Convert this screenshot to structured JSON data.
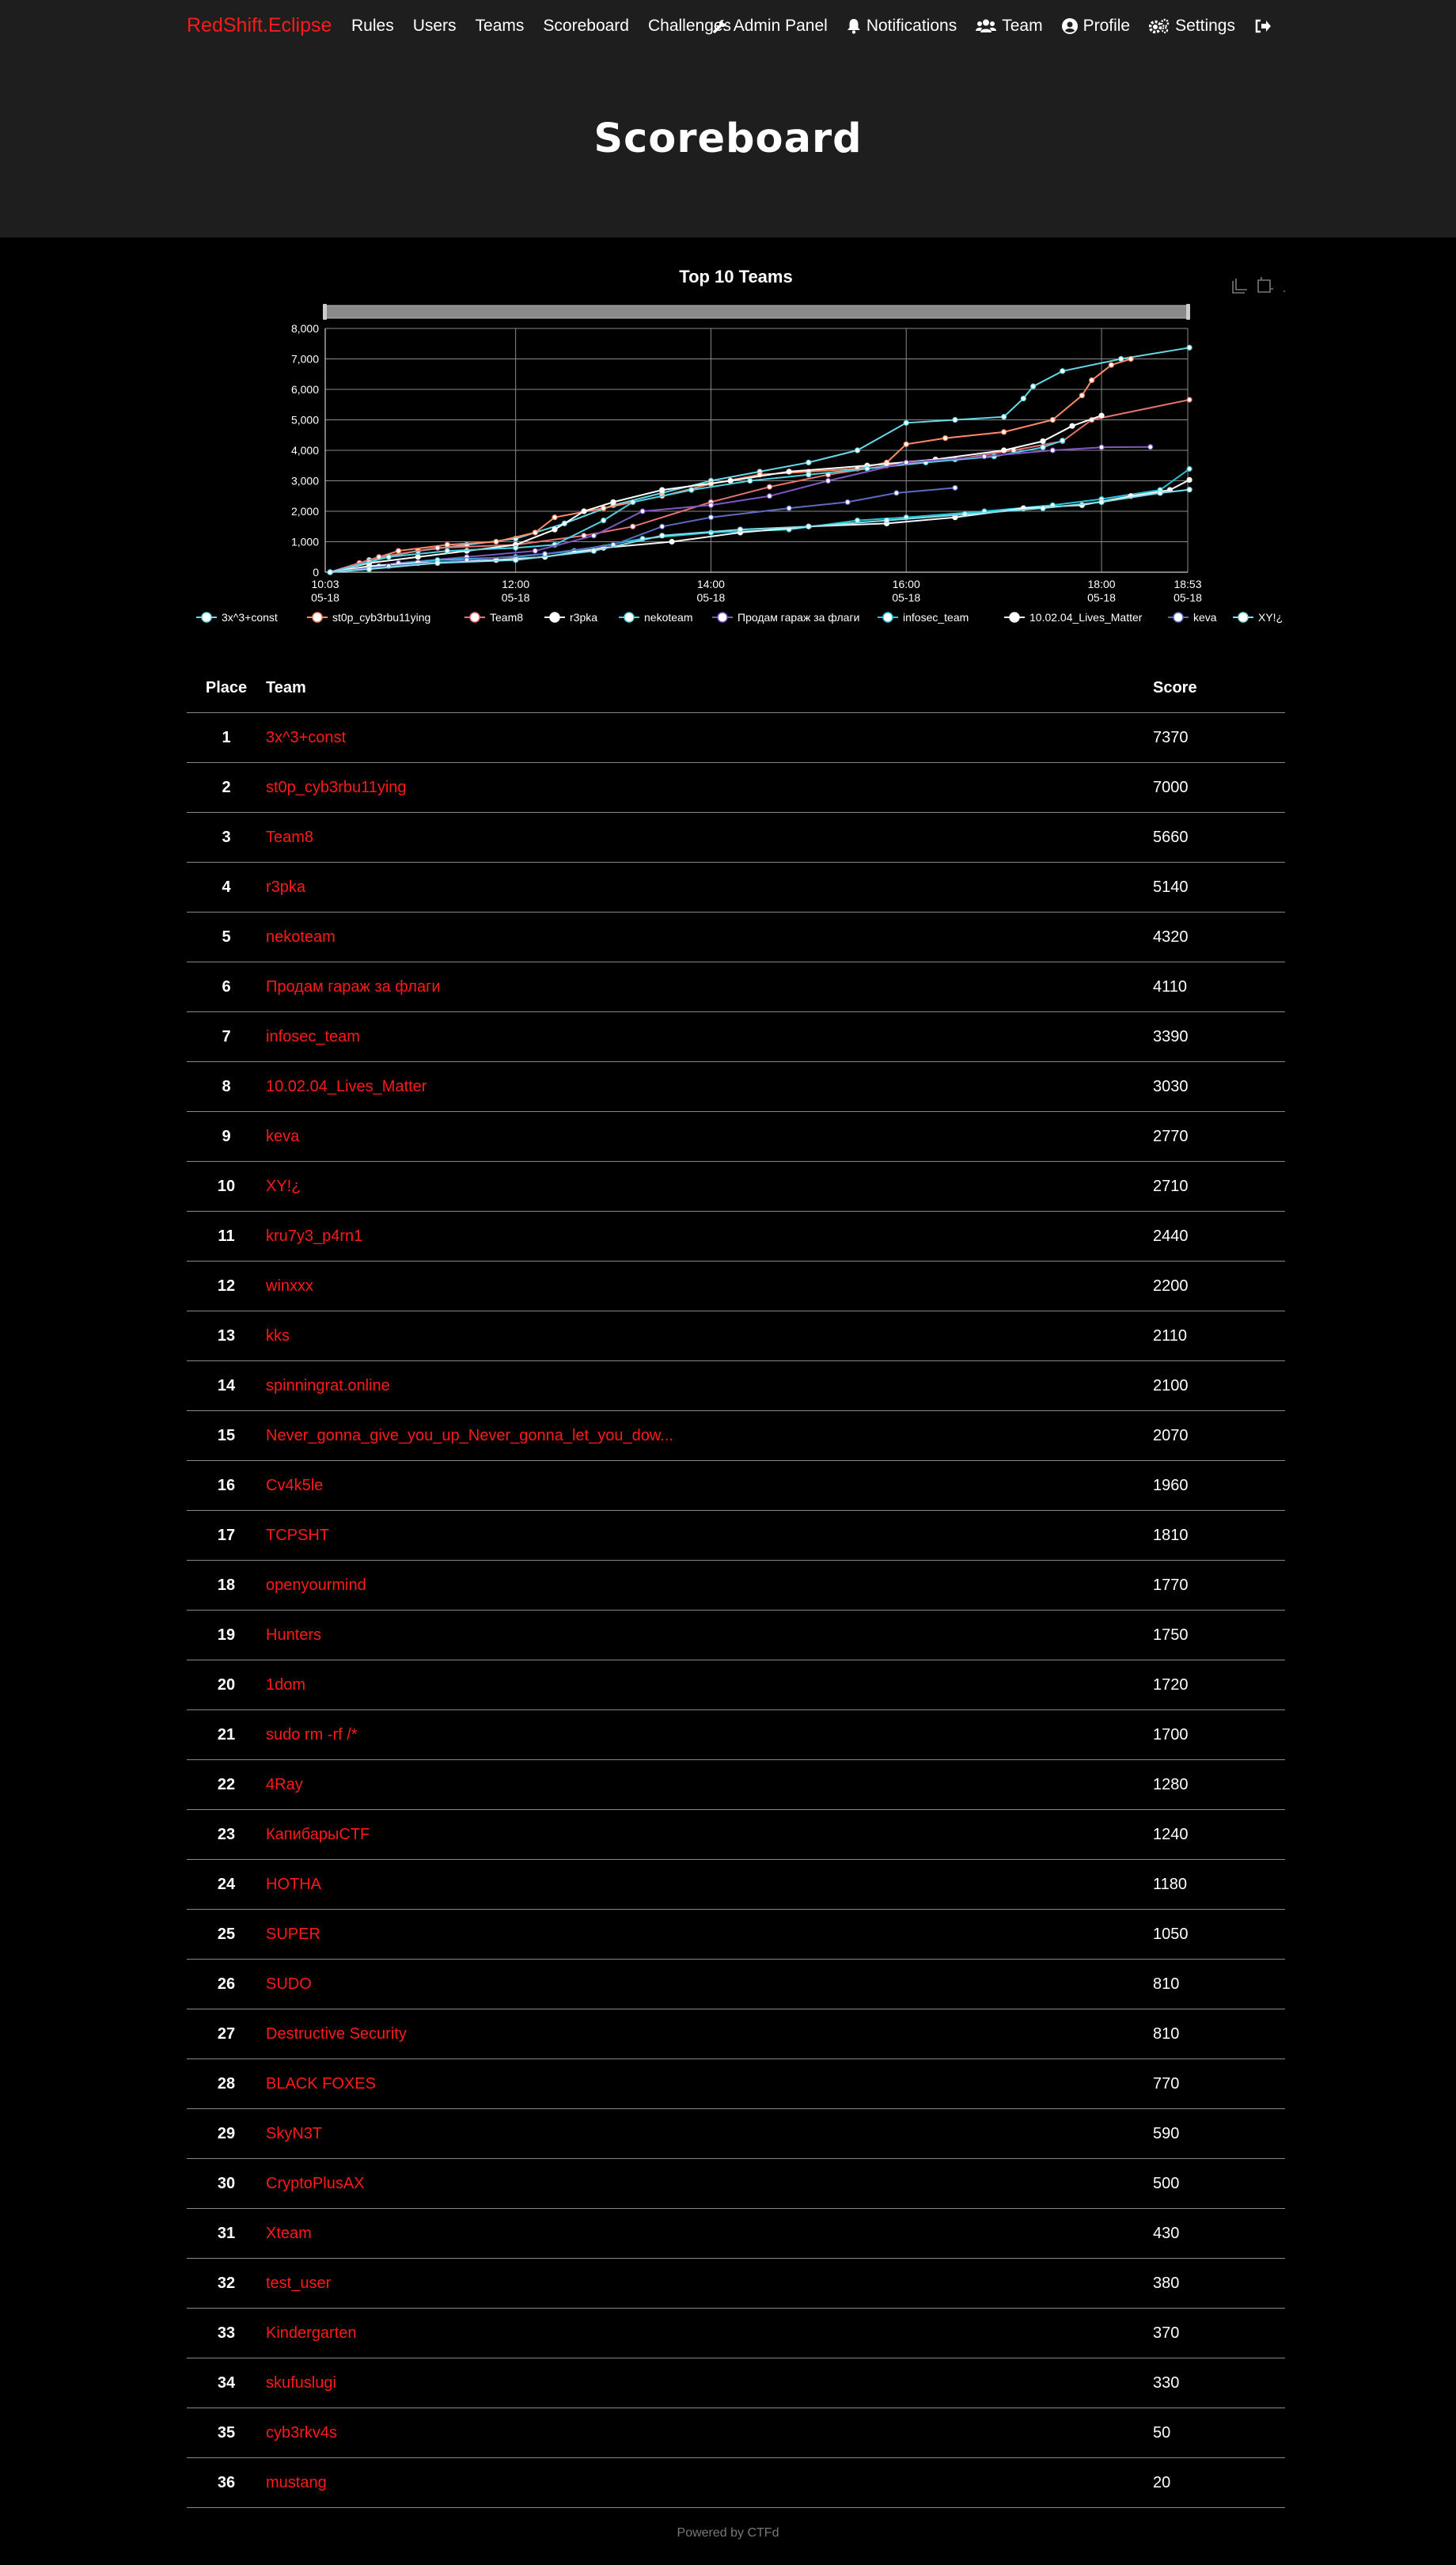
{
  "nav": {
    "brand": "RedShift.Eclipse",
    "left": [
      "Rules",
      "Users",
      "Teams",
      "Scoreboard",
      "Challenges"
    ],
    "right": {
      "admin": "Admin Panel",
      "notifications": "Notifications",
      "team": "Team",
      "profile": "Profile",
      "settings": "Settings"
    }
  },
  "page_title": "Scoreboard",
  "colors": {
    "accent": "#ff1a1a",
    "background": "#000000",
    "header_bg": "#1e1e1e"
  },
  "toolbox_icons": [
    "zoom-icon",
    "zoom-reset-icon",
    "download-icon"
  ],
  "chart_data": {
    "type": "line",
    "title": "Top 10 Teams",
    "xlabel": "",
    "ylabel": "",
    "ylim": [
      0,
      8000
    ],
    "x_range": [
      "10:03 05-18",
      "18:53 05-18"
    ],
    "x_ticks": [
      {
        "time": "10:03",
        "date": "05-18",
        "hours": 10.05
      },
      {
        "time": "12:00",
        "date": "05-18",
        "hours": 12.0
      },
      {
        "time": "14:00",
        "date": "05-18",
        "hours": 14.0
      },
      {
        "time": "16:00",
        "date": "05-18",
        "hours": 16.0
      },
      {
        "time": "18:00",
        "date": "05-18",
        "hours": 18.0
      },
      {
        "time": "18:53",
        "date": "05-18",
        "hours": 18.883
      }
    ],
    "y_ticks": [
      "0",
      "1,000",
      "2,000",
      "3,000",
      "4,000",
      "5,000",
      "6,000",
      "7,000",
      "8,000"
    ],
    "grid": true,
    "legend_position": "bottom",
    "series": [
      {
        "name": "3x^3+const",
        "color": "#66d9e8",
        "points": [
          [
            10.1,
            0
          ],
          [
            10.5,
            400
          ],
          [
            11.0,
            700
          ],
          [
            11.5,
            900
          ],
          [
            12.0,
            1100
          ],
          [
            12.5,
            1600
          ],
          [
            13.0,
            2200
          ],
          [
            13.5,
            2600
          ],
          [
            14.0,
            3000
          ],
          [
            14.5,
            3300
          ],
          [
            15.0,
            3600
          ],
          [
            15.5,
            4000
          ],
          [
            16.0,
            4900
          ],
          [
            16.5,
            5000
          ],
          [
            17.0,
            5100
          ],
          [
            17.2,
            5700
          ],
          [
            17.3,
            6100
          ],
          [
            17.6,
            6600
          ],
          [
            18.2,
            7000
          ],
          [
            18.9,
            7370
          ]
        ]
      },
      {
        "name": "st0p_cyb3rbu11ying",
        "color": "#ff8a65",
        "points": [
          [
            10.1,
            0
          ],
          [
            10.4,
            300
          ],
          [
            10.8,
            700
          ],
          [
            11.3,
            900
          ],
          [
            11.8,
            1000
          ],
          [
            12.2,
            1300
          ],
          [
            12.4,
            1800
          ],
          [
            12.9,
            2100
          ],
          [
            13.5,
            2500
          ],
          [
            14.0,
            2900
          ],
          [
            14.5,
            3200
          ],
          [
            15.0,
            3300
          ],
          [
            15.5,
            3400
          ],
          [
            15.8,
            3600
          ],
          [
            16.0,
            4200
          ],
          [
            16.4,
            4400
          ],
          [
            17.0,
            4600
          ],
          [
            17.5,
            5000
          ],
          [
            17.8,
            5800
          ],
          [
            17.9,
            6300
          ],
          [
            18.1,
            6800
          ],
          [
            18.3,
            7000
          ]
        ]
      },
      {
        "name": "Team8",
        "color": "#e57373",
        "points": [
          [
            10.1,
            0
          ],
          [
            10.6,
            500
          ],
          [
            11.2,
            800
          ],
          [
            12.0,
            900
          ],
          [
            12.7,
            1200
          ],
          [
            13.2,
            1500
          ],
          [
            14.0,
            2300
          ],
          [
            14.6,
            2800
          ],
          [
            15.2,
            3200
          ],
          [
            15.8,
            3500
          ],
          [
            16.5,
            3700
          ],
          [
            17.1,
            4000
          ],
          [
            17.6,
            4300
          ],
          [
            17.9,
            5000
          ],
          [
            18.9,
            5660
          ]
        ]
      },
      {
        "name": "r3pka",
        "color": "#ffffff",
        "points": [
          [
            10.1,
            0
          ],
          [
            10.5,
            300
          ],
          [
            11.0,
            500
          ],
          [
            11.5,
            700
          ],
          [
            12.0,
            900
          ],
          [
            12.4,
            1400
          ],
          [
            12.7,
            2000
          ],
          [
            13.0,
            2300
          ],
          [
            13.5,
            2700
          ],
          [
            14.2,
            3000
          ],
          [
            14.8,
            3300
          ],
          [
            15.6,
            3500
          ],
          [
            16.3,
            3700
          ],
          [
            17.0,
            4000
          ],
          [
            17.4,
            4300
          ],
          [
            17.7,
            4800
          ],
          [
            18.0,
            5140
          ]
        ]
      },
      {
        "name": "nekoteam",
        "color": "#4dd0e1",
        "points": [
          [
            10.1,
            0
          ],
          [
            10.7,
            500
          ],
          [
            11.3,
            700
          ],
          [
            12.0,
            800
          ],
          [
            12.4,
            900
          ],
          [
            12.9,
            1700
          ],
          [
            13.2,
            2300
          ],
          [
            13.8,
            2700
          ],
          [
            14.4,
            3000
          ],
          [
            15.0,
            3200
          ],
          [
            15.6,
            3400
          ],
          [
            16.2,
            3600
          ],
          [
            16.9,
            3800
          ],
          [
            17.4,
            4100
          ],
          [
            17.6,
            4320
          ]
        ]
      },
      {
        "name": "Продам гараж за флаги",
        "color": "#7e57c2",
        "points": [
          [
            10.1,
            0
          ],
          [
            10.8,
            300
          ],
          [
            11.5,
            500
          ],
          [
            12.2,
            700
          ],
          [
            12.8,
            1200
          ],
          [
            13.3,
            2000
          ],
          [
            14.0,
            2200
          ],
          [
            14.6,
            2500
          ],
          [
            15.2,
            3000
          ],
          [
            16.0,
            3600
          ],
          [
            16.8,
            3800
          ],
          [
            17.5,
            4000
          ],
          [
            18.0,
            4100
          ],
          [
            18.5,
            4110
          ]
        ]
      },
      {
        "name": "infosec_team",
        "color": "#26c6da",
        "points": [
          [
            10.1,
            0
          ],
          [
            10.6,
            200
          ],
          [
            11.2,
            400
          ],
          [
            12.0,
            500
          ],
          [
            12.6,
            700
          ],
          [
            13.3,
            1100
          ],
          [
            14.0,
            1300
          ],
          [
            14.8,
            1400
          ],
          [
            15.5,
            1700
          ],
          [
            16.0,
            1800
          ],
          [
            16.8,
            2000
          ],
          [
            17.5,
            2200
          ],
          [
            18.0,
            2400
          ],
          [
            18.6,
            2700
          ],
          [
            18.9,
            3390
          ]
        ]
      },
      {
        "name": "10.02.04_Lives_Matter",
        "color": "#f5f5f5",
        "points": [
          [
            10.1,
            0
          ],
          [
            10.5,
            200
          ],
          [
            11.0,
            300
          ],
          [
            11.8,
            400
          ],
          [
            12.3,
            500
          ],
          [
            12.9,
            800
          ],
          [
            13.6,
            1000
          ],
          [
            14.3,
            1300
          ],
          [
            15.0,
            1500
          ],
          [
            15.8,
            1600
          ],
          [
            16.5,
            1800
          ],
          [
            17.2,
            2100
          ],
          [
            17.8,
            2200
          ],
          [
            18.3,
            2500
          ],
          [
            18.7,
            2700
          ],
          [
            18.9,
            3030
          ]
        ]
      },
      {
        "name": "keva",
        "color": "#5c6bc0",
        "points": [
          [
            10.1,
            0
          ],
          [
            10.7,
            200
          ],
          [
            11.5,
            400
          ],
          [
            12.3,
            600
          ],
          [
            13.0,
            900
          ],
          [
            13.5,
            1500
          ],
          [
            14.0,
            1800
          ],
          [
            14.8,
            2100
          ],
          [
            15.4,
            2300
          ],
          [
            15.9,
            2600
          ],
          [
            16.5,
            2770
          ]
        ]
      },
      {
        "name": "XY!¿",
        "color": "#80deea",
        "points": [
          [
            10.1,
            0
          ],
          [
            10.5,
            100
          ],
          [
            11.2,
            300
          ],
          [
            12.0,
            400
          ],
          [
            12.8,
            700
          ],
          [
            13.5,
            1200
          ],
          [
            14.3,
            1400
          ],
          [
            15.0,
            1500
          ],
          [
            15.8,
            1700
          ],
          [
            16.6,
            1900
          ],
          [
            17.4,
            2100
          ],
          [
            18.0,
            2300
          ],
          [
            18.6,
            2600
          ],
          [
            18.9,
            2710
          ]
        ]
      }
    ]
  },
  "table": {
    "headers": {
      "place": "Place",
      "team": "Team",
      "score": "Score"
    },
    "rows": [
      {
        "place": "1",
        "team": "3x^3+const",
        "score": "7370"
      },
      {
        "place": "2",
        "team": "st0p_cyb3rbu11ying",
        "score": "7000"
      },
      {
        "place": "3",
        "team": "Team8",
        "score": "5660"
      },
      {
        "place": "4",
        "team": "r3pka",
        "score": "5140"
      },
      {
        "place": "5",
        "team": "nekoteam",
        "score": "4320"
      },
      {
        "place": "6",
        "team": "Продам гараж за флаги",
        "score": "4110"
      },
      {
        "place": "7",
        "team": "infosec_team",
        "score": "3390"
      },
      {
        "place": "8",
        "team": "10.02.04_Lives_Matter",
        "score": "3030"
      },
      {
        "place": "9",
        "team": "keva",
        "score": "2770"
      },
      {
        "place": "10",
        "team": "XY!¿",
        "score": "2710"
      },
      {
        "place": "11",
        "team": "kru7y3_p4rn1",
        "score": "2440"
      },
      {
        "place": "12",
        "team": "winxxx",
        "score": "2200"
      },
      {
        "place": "13",
        "team": "kks",
        "score": "2110"
      },
      {
        "place": "14",
        "team": "spinningrat.online",
        "score": "2100"
      },
      {
        "place": "15",
        "team": "Never_gonna_give_you_up_Never_gonna_let_you_dow...",
        "score": "2070"
      },
      {
        "place": "16",
        "team": "Cv4k5le",
        "score": "1960"
      },
      {
        "place": "17",
        "team": "TCPSHT",
        "score": "1810"
      },
      {
        "place": "18",
        "team": "openyourmind",
        "score": "1770"
      },
      {
        "place": "19",
        "team": "Hunters",
        "score": "1750"
      },
      {
        "place": "20",
        "team": "1dom",
        "score": "1720"
      },
      {
        "place": "21",
        "team": "sudo rm -rf /*",
        "score": "1700"
      },
      {
        "place": "22",
        "team": "4Ray",
        "score": "1280"
      },
      {
        "place": "23",
        "team": "КапибарыCTF",
        "score": "1240"
      },
      {
        "place": "24",
        "team": "HOTHA",
        "score": "1180"
      },
      {
        "place": "25",
        "team": "SUPER",
        "score": "1050"
      },
      {
        "place": "26",
        "team": "SUDO",
        "score": "810"
      },
      {
        "place": "27",
        "team": "Destructive Security",
        "score": "810"
      },
      {
        "place": "28",
        "team": "BLACK FOXES",
        "score": "770"
      },
      {
        "place": "29",
        "team": "SkyN3T",
        "score": "590"
      },
      {
        "place": "30",
        "team": "CryptoPlusAX",
        "score": "500"
      },
      {
        "place": "31",
        "team": "Xteam",
        "score": "430"
      },
      {
        "place": "32",
        "team": "test_user",
        "score": "380"
      },
      {
        "place": "33",
        "team": "Kindergarten",
        "score": "370"
      },
      {
        "place": "34",
        "team": "skufuslugi",
        "score": "330"
      },
      {
        "place": "35",
        "team": "cyb3rkv4s",
        "score": "50"
      },
      {
        "place": "36",
        "team": "mustang",
        "score": "20"
      }
    ]
  },
  "footer": "Powered by CTFd"
}
